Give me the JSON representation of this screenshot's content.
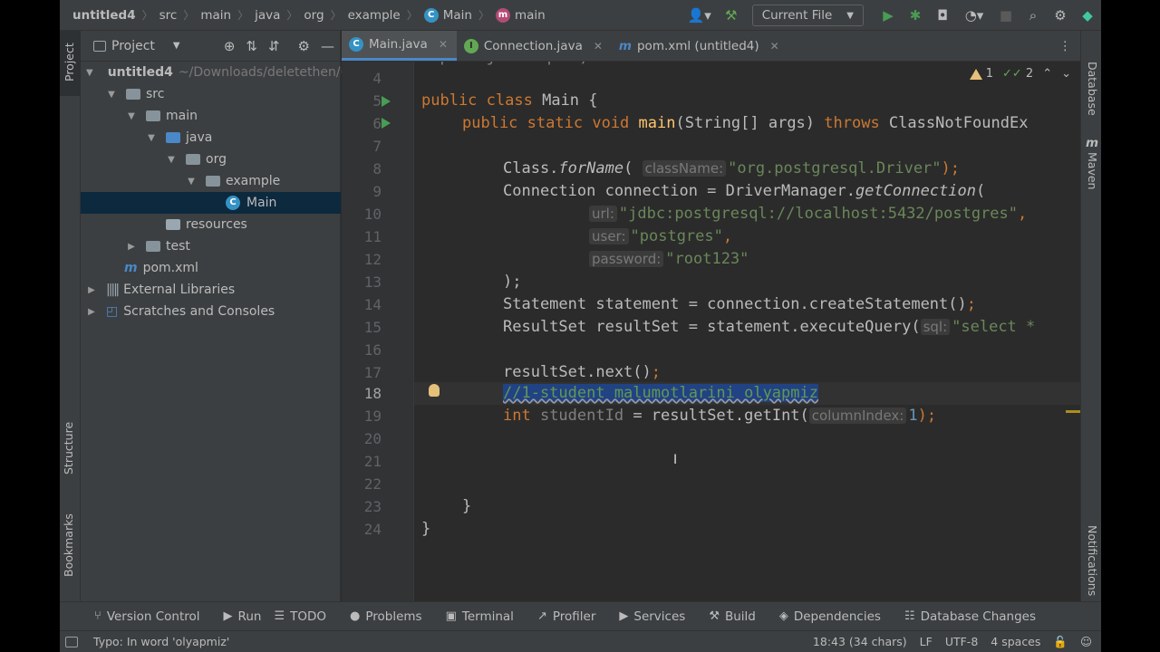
{
  "titlebar": {
    "breadcrumbs": [
      "untitled4",
      "src",
      "main",
      "java",
      "org",
      "example",
      "Main",
      "main"
    ],
    "run_config": "Current File",
    "icons": [
      "user-icon",
      "hammer-icon",
      "run-icon",
      "debug-icon",
      "coverage-icon",
      "profile-icon",
      "stop-icon",
      "search-icon",
      "settings-icon",
      "toolbox-icon"
    ]
  },
  "left_strip": {
    "project": "Project",
    "structure": "Structure",
    "bookmarks": "Bookmarks"
  },
  "right_strip": {
    "database": "Database",
    "maven": "Maven",
    "notifications": "Notifications"
  },
  "project_panel": {
    "title": "Project",
    "tree": [
      {
        "label": "untitled4",
        "extra": "~/Downloads/deletethen/u",
        "level": 0,
        "expanded": true,
        "icon": "module-folder-icon",
        "bold": true
      },
      {
        "label": "src",
        "level": 1,
        "expanded": true,
        "icon": "folder-icon"
      },
      {
        "label": "main",
        "level": 2,
        "expanded": true,
        "icon": "folder-icon"
      },
      {
        "label": "java",
        "level": 3,
        "expanded": true,
        "icon": "source-folder-icon"
      },
      {
        "label": "org",
        "level": 4,
        "expanded": true,
        "icon": "package-icon"
      },
      {
        "label": "example",
        "level": 5,
        "expanded": true,
        "icon": "package-icon"
      },
      {
        "label": "Main",
        "level": 6,
        "icon": "class-icon",
        "selected": true
      },
      {
        "label": "resources",
        "level": 3,
        "icon": "resources-folder-icon"
      },
      {
        "label": "test",
        "level": 2,
        "expanded": false,
        "icon": "folder-icon"
      },
      {
        "label": "pom.xml",
        "level": 1,
        "icon": "maven-icon"
      },
      {
        "label": "External Libraries",
        "level": 0,
        "expanded": false,
        "icon": "libraries-icon"
      },
      {
        "label": "Scratches and Consoles",
        "level": 0,
        "expanded": false,
        "icon": "scratches-icon"
      }
    ]
  },
  "editor_tabs": [
    {
      "label": "Main.java",
      "icon": "C",
      "active": true
    },
    {
      "label": "Connection.java",
      "icon": "I",
      "active": false
    },
    {
      "label": "pom.xml (untitled4)",
      "icon": "m",
      "active": false
    }
  ],
  "inspections": {
    "warnings": "1",
    "weak_warnings": "2"
  },
  "editor": {
    "line_numbers": [
      "4",
      "5",
      "6",
      "7",
      "8",
      "9",
      "10",
      "11",
      "12",
      "13",
      "14",
      "15",
      "16",
      "17",
      "18",
      "19",
      "20",
      "21",
      "22",
      "23",
      "24"
    ],
    "current_line": "18",
    "top_partial": "import java.sql.*;",
    "l5_kw1": "public",
    "l5_kw2": "class",
    "l5_name": " Main {",
    "l6_kw1": "public",
    "l6_kw2": "static",
    "l6_kw3": "void",
    "l6_fn": "main",
    "l6_rest": "(String[] args) ",
    "l6_kw4": "throws",
    "l6_tail": " ClassNotFoundEx",
    "l8_a": "Class.",
    "l8_fn": "forName",
    "l8_b": "(",
    "l8_hint": "className:",
    "l8_str": "\"org.postgresql.Driver\"",
    "l8_c": ");",
    "l9_a": "Connection connection = DriverManager.",
    "l9_fn": "getConnection",
    "l9_b": "(",
    "l10_hint": "url:",
    "l10_str": "\"jdbc:postgresql://localhost:5432/postgres\"",
    "l10_c": ",",
    "l11_hint": "user:",
    "l11_str": "\"postgres\"",
    "l11_c": ",",
    "l12_hint": "password:",
    "l12_str": "\"root123\"",
    "l13": ");",
    "l14_a": "Statement statement = connection.createStatement()",
    "l14_c": ";",
    "l15_a": "ResultSet resultSet = statement.executeQuery(",
    "l15_hint": "sql:",
    "l15_str": "\"select *",
    "l17_a": "resultSet.next()",
    "l17_c": ";",
    "l18_comment": "//1-student malumotlarini olyapmiz",
    "l19_kw": "int",
    "l19_var": " studentId",
    "l19_a": " = resultSet.getInt(",
    "l19_hint": "columnIndex:",
    "l19_num": "1",
    "l19_c": ");",
    "l23": "}",
    "l24": "}"
  },
  "bottom_tools": [
    {
      "label": "Version Control",
      "icon": "branch-icon"
    },
    {
      "label": "Run",
      "icon": "run-icon"
    },
    {
      "label": "TODO",
      "icon": "todo-icon"
    },
    {
      "label": "Problems",
      "icon": "problems-icon"
    },
    {
      "label": "Terminal",
      "icon": "terminal-icon"
    },
    {
      "label": "Profiler",
      "icon": "profiler-icon"
    },
    {
      "label": "Services",
      "icon": "services-icon"
    },
    {
      "label": "Build",
      "icon": "build-icon"
    },
    {
      "label": "Dependencies",
      "icon": "dependencies-icon"
    },
    {
      "label": "Database Changes",
      "icon": "database-changes-icon"
    }
  ],
  "status": {
    "message": "Typo: In word 'olyapmiz'",
    "position": "18:43 (34 chars)",
    "line_sep": "LF",
    "encoding": "UTF-8",
    "indent": "4 spaces"
  },
  "colors": {
    "keyword": "#cc7832",
    "function": "#ffc66d",
    "string": "#6a8759",
    "number": "#6897bb",
    "selection": "#214283",
    "accent": "#4a88c7"
  }
}
